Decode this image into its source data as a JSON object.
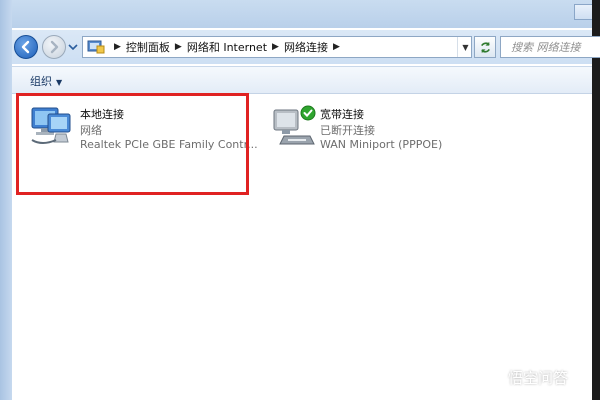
{
  "nav": {
    "breadcrumbs": [
      "控制面板",
      "网络和 Internet",
      "网络连接"
    ],
    "search_placeholder": "搜索 网络连接"
  },
  "command_bar": {
    "organize_label": "组织"
  },
  "connections": [
    {
      "name": "本地连接",
      "status": "网络",
      "device": "Realtek PCIe GBE Family Contr...",
      "highlighted": true
    },
    {
      "name": "宽带连接",
      "status": "已断开连接",
      "device": "WAN Miniport (PPPOE)",
      "highlighted": false
    }
  ],
  "watermark": {
    "text": "悟空问答"
  },
  "colors": {
    "highlight_border": "#e02222",
    "status_gray": "#6d6d6d",
    "check_green": "#2fa52f"
  },
  "icons": {
    "back": "arrow-left-icon",
    "forward": "arrow-right-icon",
    "refresh": "refresh-icon",
    "network": "network-computer-icon",
    "broadband": "broadband-modem-icon"
  }
}
